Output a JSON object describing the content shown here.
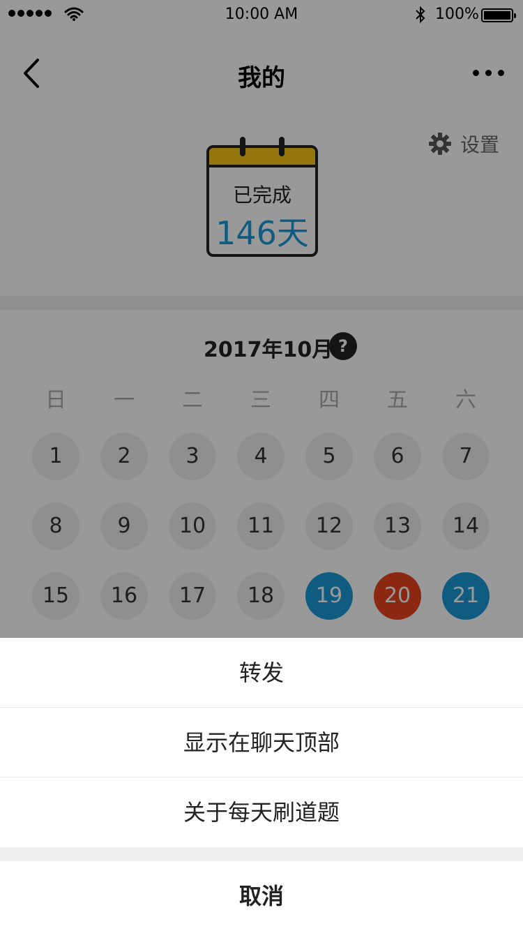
{
  "status_bar": {
    "time": "10:00 AM",
    "battery": "100%"
  },
  "nav": {
    "title": "我的"
  },
  "hero": {
    "settings_label": "设置",
    "completed_label": "已完成",
    "completed_days": "146天"
  },
  "calendar": {
    "month": "2017年10月",
    "help": "?",
    "weekdays": [
      "日",
      "一",
      "二",
      "三",
      "四",
      "五",
      "六"
    ],
    "days": [
      "1",
      "2",
      "3",
      "4",
      "5",
      "6",
      "7",
      "8",
      "9",
      "10",
      "11",
      "12",
      "13",
      "14",
      "15",
      "16",
      "17",
      "18",
      "19",
      "20",
      "21"
    ],
    "highlighted_blue": [
      "19",
      "21"
    ],
    "highlighted_red": [
      "20"
    ]
  },
  "colors": {
    "accent_blue": "#1a9ad6",
    "accent_red": "#e8431f",
    "calendar_top": "#f5c518"
  },
  "action_sheet": {
    "items": [
      "转发",
      "显示在聊天顶部",
      "关于每天刷道题"
    ],
    "cancel": "取消"
  }
}
